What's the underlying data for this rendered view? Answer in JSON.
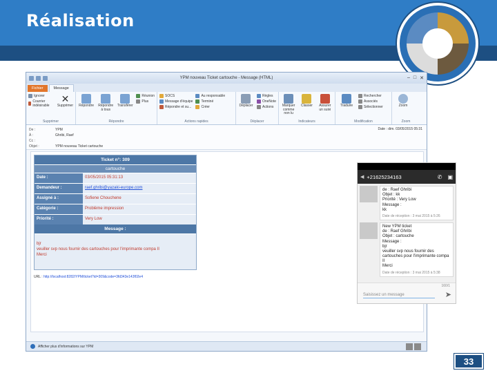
{
  "slide": {
    "title": "Réalisation",
    "page_number": "33"
  },
  "outlook": {
    "window_title": "YPM nouveau Ticket cartouche - Message (HTML)",
    "tabs": [
      "Fichier",
      "Message"
    ],
    "ribbon": {
      "supprimer": {
        "items": [
          "Ignorer",
          "Courrier indésirable"
        ],
        "button": "Supprimer",
        "label": "Supprimer"
      },
      "repondre": {
        "buttons": [
          "Répondre",
          "Répondre à tous",
          "Transférer"
        ],
        "more": [
          "Réunion",
          "Plus"
        ],
        "label": "Répondre"
      },
      "actions": {
        "items": [
          "SOCS",
          "Message d'équipe",
          "Répondre et su..."
        ],
        "items2": [
          "Au responsable",
          "Terminé",
          "Créer"
        ],
        "label": "Actions rapides"
      },
      "deplacer": {
        "buttons": [
          "Déplacer"
        ],
        "items": [
          "Règles",
          "OneNote",
          "Actions"
        ],
        "label": "Déplacer"
      },
      "indicateurs": {
        "buttons": [
          "Marquer comme non lu",
          "Classer",
          "Assurer un suivi"
        ],
        "label": "Indicateurs"
      },
      "modification": {
        "buttons": [
          "Traduire"
        ],
        "items": [
          "Rechercher",
          "Associés",
          "Sélectionner"
        ],
        "label": "Modification"
      },
      "zoom": {
        "button": "Zoom",
        "label": "Zoom"
      }
    },
    "header": {
      "de_label": "De :",
      "de_value": "YPM",
      "a_label": "À :",
      "a_value": "Ghribi, Raef",
      "cc_label": "Cc :",
      "cc_value": "",
      "objet_label": "Objet :",
      "objet_value": "YPM nouveau Ticket cartouche",
      "date_label": "Date :",
      "date_value": "dim. 03/05/2015 05:31"
    },
    "ticket": {
      "heading": "Ticket n°: 309",
      "subject": "cartouche",
      "rows": [
        {
          "key": "Date :",
          "value": "03/05/2015 05:31:13"
        },
        {
          "key": "Demandeur :",
          "value": "raef.ghribi@yazaki-europe.com"
        },
        {
          "key": "Assigné à :",
          "value": "Sofiene Chouchene"
        },
        {
          "key": "Catégorie :",
          "value": "Problème impression"
        },
        {
          "key": "Priorité :",
          "value": "Very Low"
        }
      ],
      "message_label": "Message :",
      "message_lines": [
        "bjr",
        "veuiller svp nous fournir des cartouches pour l'imprimante compa II",
        "Merci"
      ]
    },
    "url_label": "URL :",
    "url_value": "http://localhost:8282/YPM/ticket?id=309&code=3fd343e143f02e4",
    "statusbar": "Afficher plus d'informations sur YPM"
  },
  "phone": {
    "contact": "+21625234163",
    "messages": [
      {
        "lines": [
          "de : Raef Ghribi",
          "Objet : kk",
          "Priorité : Very Low",
          "Message :",
          "kk"
        ],
        "date": "Date de réception : 3 mai 2015 à 5:26"
      },
      {
        "lines": [
          "New YPM ticket",
          "de : Raef Ghribi",
          "Objet : cartouche",
          "Message :",
          "bjr",
          "veuiller svp nous fournir des cartouches pour l'imprimante compa II",
          "Merci"
        ],
        "date": "Date de réception : 3 mai 2015 à 5:38"
      }
    ],
    "counter": "160/1",
    "input_placeholder": "Saisissez un message"
  }
}
